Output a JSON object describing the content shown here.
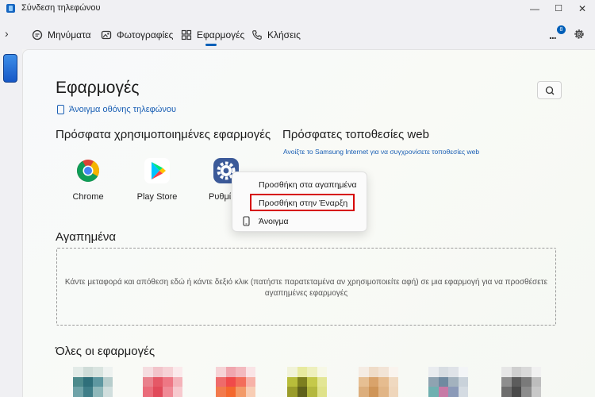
{
  "window": {
    "title": "Σύνδεση τηλεφώνου",
    "controls": {
      "minimize": "—",
      "maximize": "☐",
      "close": "✕"
    }
  },
  "nav": {
    "tabs": [
      {
        "label": "Μηνύματα",
        "icon": "chat-icon"
      },
      {
        "label": "Φωτογραφίες",
        "icon": "photo-icon"
      },
      {
        "label": "Εφαρμογές",
        "icon": "apps-icon",
        "active": true
      },
      {
        "label": "Κλήσεις",
        "icon": "phone-icon"
      }
    ],
    "notification_count": "8",
    "accent": "#005fb8"
  },
  "page": {
    "title": "Εφαρμογές",
    "open_phone_screen": "Άνοιγμα οθόνης τηλεφώνου",
    "recent_apps_heading": "Πρόσφατα χρησιμοποιημένες εφαρμογές",
    "recent_web_heading": "Πρόσφατες τοποθεσίες web",
    "web_link": "Ανοίξτε το Samsung Internet για να συγχρονίσετε τοποθεσίες web",
    "recent_apps": [
      {
        "label": "Chrome",
        "icon": "chrome-icon"
      },
      {
        "label": "Play Store",
        "icon": "play-store-icon"
      },
      {
        "label": "Ρυθμί",
        "icon": "settings-icon"
      }
    ],
    "favorites_heading": "Αγαπημένα",
    "favorites_hint": "Κάντε μεταφορά και απόθεση εδώ ή κάντε δεξιό κλικ (πατήστε παρατεταμένα αν χρησιμοποιείτε αφή) σε μια εφαρμογή για να προσθέσετε αγαπημένες εφαρμογές",
    "all_apps_heading": "Όλες οι εφαρμογές"
  },
  "context_menu": {
    "items": [
      {
        "label": "Προσθήκη στα αγαπημένα"
      },
      {
        "label": "Προσθήκη στην Έναρξη",
        "highlighted": true
      },
      {
        "label": "Άνοιγμα",
        "icon": "phone-icon"
      }
    ],
    "highlight_color": "#d60000"
  }
}
